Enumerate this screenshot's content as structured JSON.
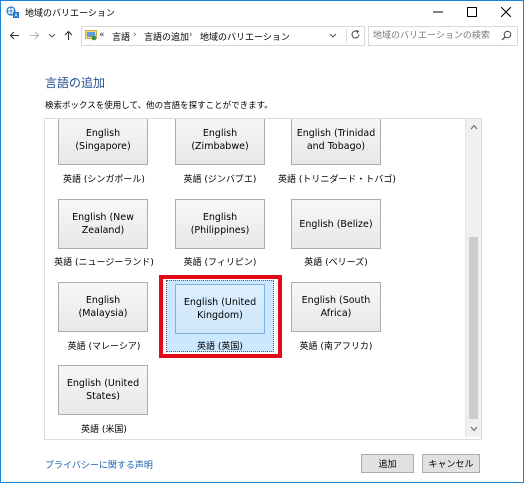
{
  "window": {
    "title": "地域のバリエーション"
  },
  "breadcrumb": [
    "言語",
    "言語の追加",
    "地域のバリエーション"
  ],
  "breadcrumb_prefix": "«",
  "search": {
    "placeholder": "地域のバリエーションの検索"
  },
  "main": {
    "title": "言語の追加",
    "description": "検索ボックスを使用して、他の言語を探すことができます。"
  },
  "languages": [
    {
      "name": "English\n(Singapore)",
      "caption": "英語 (シンガポール)"
    },
    {
      "name": "English\n(Zimbabwe)",
      "caption": "英語 (ジンバブエ)"
    },
    {
      "name": "English (Trinidad\nand Tobago)",
      "caption": "英語 (トリニダード・トバゴ)"
    },
    {
      "name": "English (New\nZealand)",
      "caption": "英語 (ニュージーランド)"
    },
    {
      "name": "English\n(Philippines)",
      "caption": "英語 (フィリピン)"
    },
    {
      "name": "English (Belize)",
      "caption": "英語 (ベリーズ)"
    },
    {
      "name": "English (Malaysia)",
      "caption": "英語 (マレーシア)"
    },
    {
      "name": "English (United\nKingdom)",
      "caption": "英語 (英国)",
      "selected": true
    },
    {
      "name": "English (South\nAfrica)",
      "caption": "英語 (南アフリカ)"
    },
    {
      "name": "English (United\nStates)",
      "caption": "英語 (米国)"
    }
  ],
  "footer": {
    "privacy_link": "プライバシーに関する声明",
    "add_label": "追加",
    "cancel_label": "キャンセル"
  },
  "colors": {
    "accent": "#1e4e8c",
    "highlight": "#e30a17",
    "selection": "#cce8ff"
  }
}
